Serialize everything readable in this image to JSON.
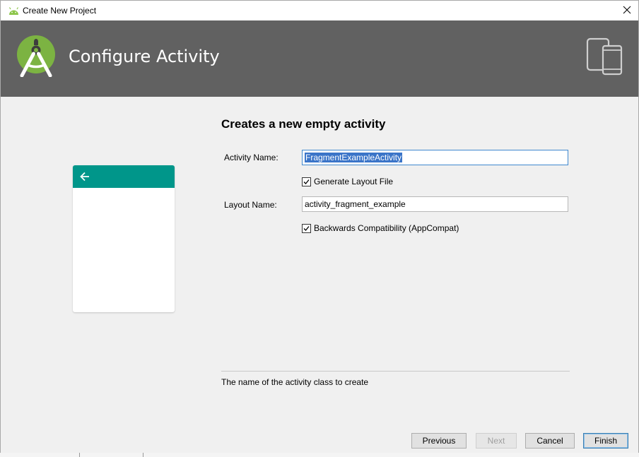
{
  "window": {
    "title": "Create New Project"
  },
  "banner": {
    "heading": "Configure Activity",
    "color": "#616161"
  },
  "preview": {
    "appbar_color": "#00968a"
  },
  "form": {
    "title": "Creates a new empty activity",
    "activity_name": {
      "label": "Activity Name:",
      "value": "FragmentExampleActivity"
    },
    "generate_layout": {
      "label": "Generate Layout File",
      "checked": true
    },
    "layout_name": {
      "label": "Layout Name:",
      "value": "activity_fragment_example"
    },
    "backwards_compat": {
      "label": "Backwards Compatibility (AppCompat)",
      "checked": true
    },
    "hint": "The name of the activity class to create"
  },
  "buttons": {
    "previous": "Previous",
    "next": "Next",
    "cancel": "Cancel",
    "finish": "Finish"
  },
  "icons": {
    "app": "android-icon",
    "close": "close-icon",
    "logo": "android-studio-logo",
    "devices": "devices-icon",
    "back": "back-arrow-icon"
  }
}
